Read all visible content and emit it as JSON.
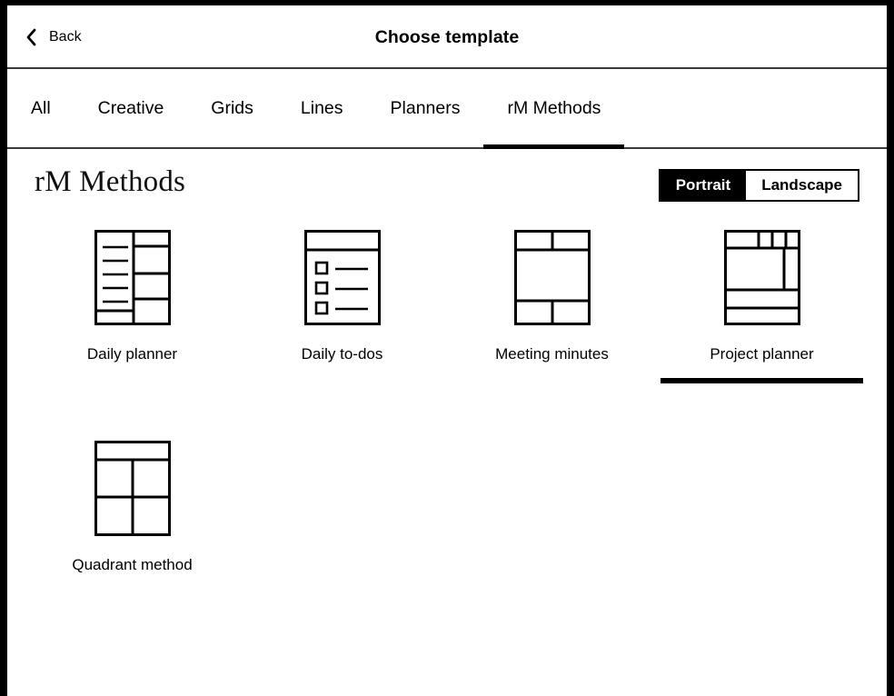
{
  "top_bar": {
    "back_label": "Back",
    "back_icon": "chevron-left-icon",
    "title": "Choose template"
  },
  "tabs": [
    {
      "label": "All",
      "active": false
    },
    {
      "label": "Creative",
      "active": false
    },
    {
      "label": "Grids",
      "active": false
    },
    {
      "label": "Lines",
      "active": false
    },
    {
      "label": "Planners",
      "active": false
    },
    {
      "label": "rM Methods",
      "active": true
    }
  ],
  "section": {
    "title": "rM Methods"
  },
  "orientation_toggle": {
    "options": [
      {
        "label": "Portrait",
        "selected": true
      },
      {
        "label": "Landscape",
        "selected": false
      }
    ]
  },
  "templates": [
    {
      "label": "Daily planner",
      "thumb": "daily-planner-thumb",
      "selected": false
    },
    {
      "label": "Daily to-dos",
      "thumb": "daily-todos-thumb",
      "selected": false
    },
    {
      "label": "Meeting minutes",
      "thumb": "meeting-minutes-thumb",
      "selected": false
    },
    {
      "label": "Project planner",
      "thumb": "project-planner-thumb",
      "selected": true
    },
    {
      "label": "Quadrant method",
      "thumb": "quadrant-method-thumb",
      "selected": false
    }
  ],
  "colors": {
    "bezel": "#000000",
    "screen": "#ffffff",
    "divider": "#3b3b3b",
    "accent": "#000000",
    "text": "#000000"
  }
}
